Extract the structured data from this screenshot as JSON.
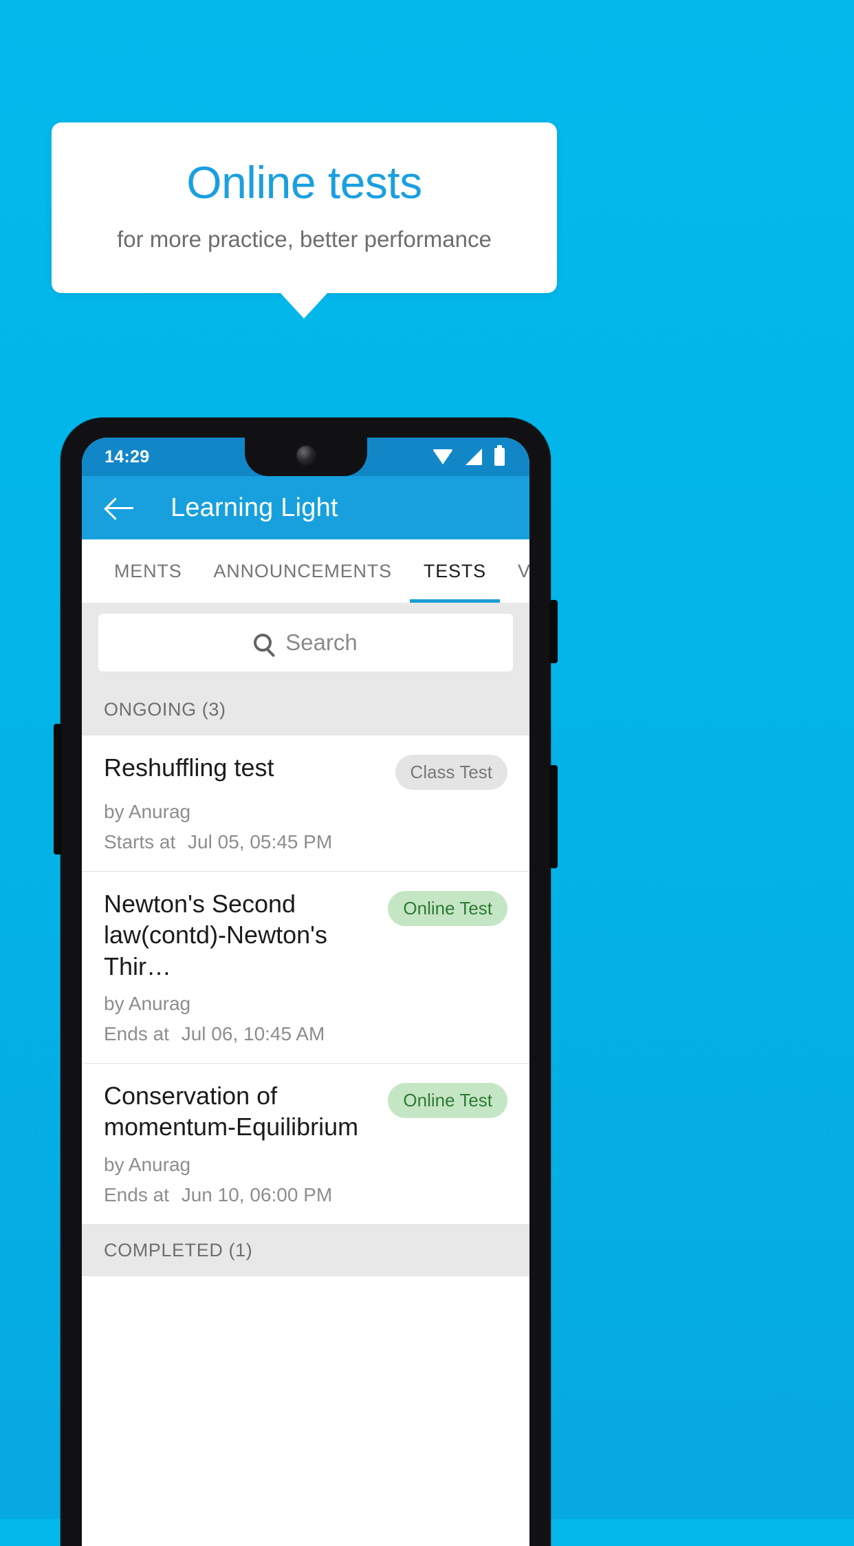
{
  "promo": {
    "title": "Online tests",
    "subtitle": "for more practice, better performance"
  },
  "phone": {
    "status_bar": {
      "time": "14:29",
      "icons": [
        "wifi-icon",
        "signal-icon",
        "battery-icon"
      ]
    },
    "app_bar": {
      "back_icon": "back-arrow-icon",
      "title": "Learning Light"
    },
    "tabs": [
      {
        "label": "MENTS",
        "active": false
      },
      {
        "label": "ANNOUNCEMENTS",
        "active": false
      },
      {
        "label": "TESTS",
        "active": true
      },
      {
        "label": "VIDEOS",
        "active": false
      }
    ],
    "search": {
      "icon": "search-icon",
      "placeholder": "Search",
      "value": ""
    },
    "sections": [
      {
        "header": "ONGOING (3)",
        "items": [
          {
            "title": "Reshuffling test",
            "badge": "Class Test",
            "badge_type": "gray",
            "author": "by Anurag",
            "time_label": "Starts at",
            "time_value": "Jul 05, 05:45 PM"
          },
          {
            "title": "Newton's Second law(contd)-Newton's Thir…",
            "badge": "Online Test",
            "badge_type": "green",
            "author": "by Anurag",
            "time_label": "Ends at",
            "time_value": "Jul 06, 10:45 AM"
          },
          {
            "title": "Conservation of momentum-Equilibrium",
            "badge": "Online Test",
            "badge_type": "green",
            "author": "by Anurag",
            "time_label": "Ends at",
            "time_value": "Jun 10, 06:00 PM"
          }
        ]
      },
      {
        "header": "COMPLETED (1)",
        "items": []
      }
    ]
  },
  "colors": {
    "background": "#03b4e8",
    "accent_blue": "#1a9fe0",
    "appbar_blue": "#17a0dd",
    "statusbar_blue": "#1287c8",
    "badge_green_bg": "#c5e6c5",
    "badge_green_text": "#2e7a32",
    "badge_gray_bg": "#e4e4e4",
    "badge_gray_text": "#787878"
  }
}
